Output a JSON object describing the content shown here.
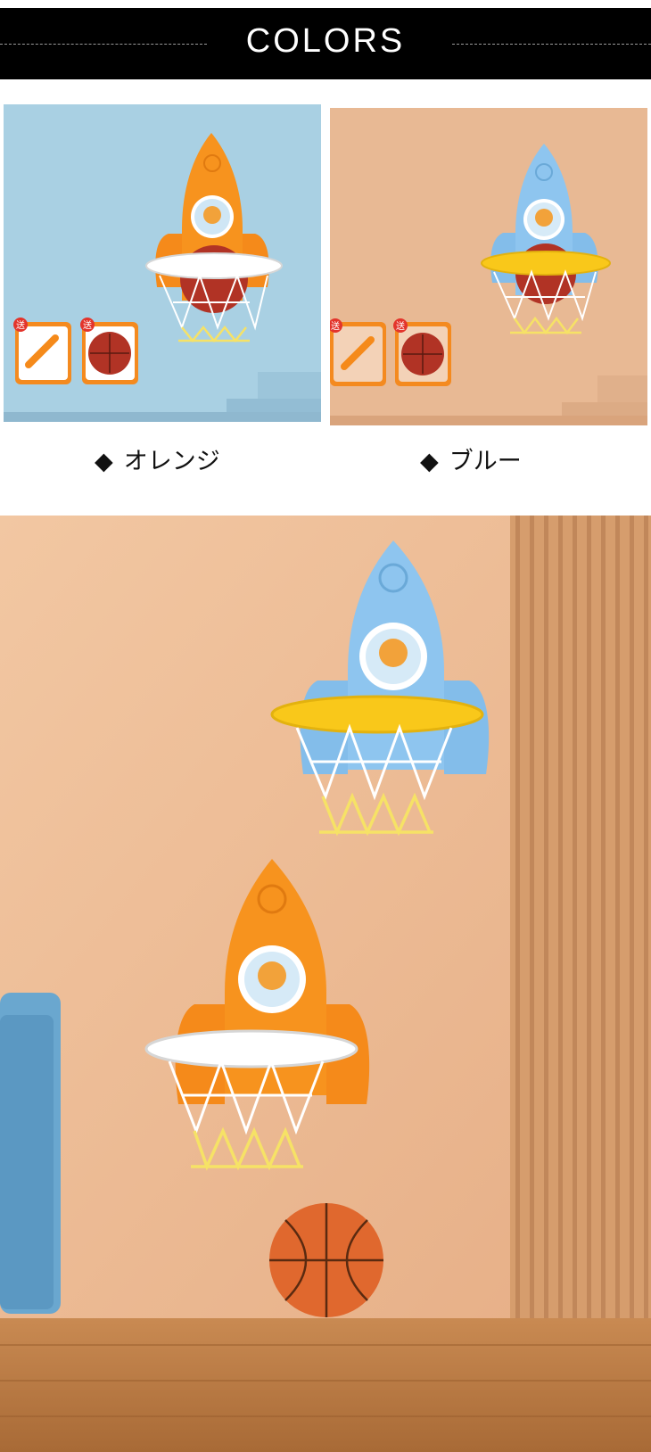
{
  "header": {
    "title": "COLORS"
  },
  "variants": [
    {
      "label": "オレンジ",
      "marker": "◆",
      "rocket_color": "#f7931e",
      "rim_color": "#ffffff",
      "background": "#a8cfe2"
    },
    {
      "label": "ブルー",
      "marker": "◆",
      "rocket_color": "#8ec5ef",
      "rim_color": "#f9c81a",
      "background": "#e7b892"
    }
  ],
  "badges": {
    "gift_label": "送"
  },
  "icons": [
    "rocket-hoop",
    "pump-icon",
    "basketball-icon"
  ]
}
